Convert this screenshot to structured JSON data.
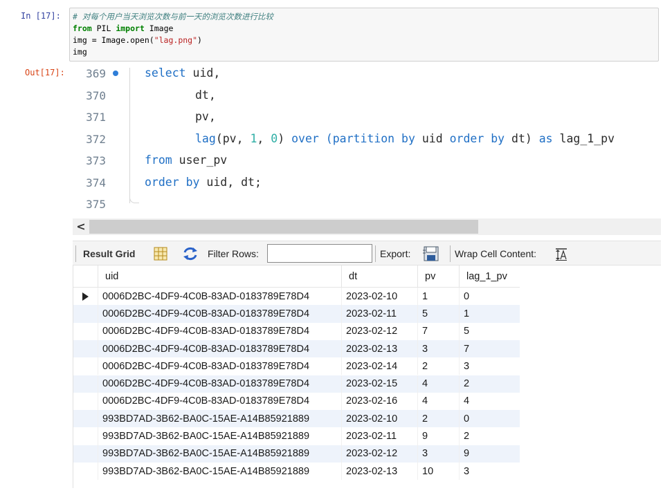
{
  "notebook": {
    "in_prompt": "In  [17]:",
    "out_prompt": "Out[17]:",
    "input_comment": "# 对每个用户当天浏览次数与前一天的浏览次数进行比较",
    "input_line2_kw1": "from",
    "input_line2_mid": " PIL ",
    "input_line2_kw2": "import",
    "input_line2_end": " Image",
    "input_line3_pre": "img = Image.open(",
    "input_line3_str": "\"lag.png\"",
    "input_line3_post": ")",
    "input_line4": "img"
  },
  "editor": {
    "lines": [
      {
        "num": "369"
      },
      {
        "num": "370"
      },
      {
        "num": "371"
      },
      {
        "num": "372"
      },
      {
        "num": "373"
      },
      {
        "num": "374"
      },
      {
        "num": "375"
      }
    ],
    "tokens": {
      "select": "select",
      "uid_comma": " uid,",
      "dt_comma": "dt,",
      "pv_comma": "pv,",
      "lag": "lag",
      "lag_args_a": "(pv, ",
      "one": "1",
      "comma_sp": ", ",
      "zero": "0",
      "close_paren": ")",
      "over": " over ",
      "paren_partition": "(partition by",
      "uid_sp": " uid ",
      "order_by": "order by",
      "dt_close": " dt) ",
      "as": "as",
      "alias": " lag_1_pv",
      "from": "from",
      "user_pv": " user_pv",
      "order_by2": "order by",
      "tail": " uid, dt;"
    }
  },
  "scrollbar": {
    "left_arrow": "<"
  },
  "toolbar": {
    "result_grid": "Result Grid",
    "filter_rows": "Filter Rows:",
    "filter_value": "",
    "export": "Export:",
    "wrap_cell": "Wrap Cell Content:",
    "icons": [
      "grid-icon",
      "refresh-icon",
      "export-icon",
      "wrap-icon"
    ]
  },
  "grid": {
    "columns": [
      "uid",
      "dt",
      "pv",
      "lag_1_pv"
    ],
    "rows": [
      [
        "0006D2BC-4DF9-4C0B-83AD-0183789E78D4",
        "2023-02-10",
        "1",
        "0"
      ],
      [
        "0006D2BC-4DF9-4C0B-83AD-0183789E78D4",
        "2023-02-11",
        "5",
        "1"
      ],
      [
        "0006D2BC-4DF9-4C0B-83AD-0183789E78D4",
        "2023-02-12",
        "7",
        "5"
      ],
      [
        "0006D2BC-4DF9-4C0B-83AD-0183789E78D4",
        "2023-02-13",
        "3",
        "7"
      ],
      [
        "0006D2BC-4DF9-4C0B-83AD-0183789E78D4",
        "2023-02-14",
        "2",
        "3"
      ],
      [
        "0006D2BC-4DF9-4C0B-83AD-0183789E78D4",
        "2023-02-15",
        "4",
        "2"
      ],
      [
        "0006D2BC-4DF9-4C0B-83AD-0183789E78D4",
        "2023-02-16",
        "4",
        "4"
      ],
      [
        "993BD7AD-3B62-BA0C-15AE-A14B85921889",
        "2023-02-10",
        "2",
        "0"
      ],
      [
        "993BD7AD-3B62-BA0C-15AE-A14B85921889",
        "2023-02-11",
        "9",
        "2"
      ],
      [
        "993BD7AD-3B62-BA0C-15AE-A14B85921889",
        "2023-02-12",
        "3",
        "9"
      ],
      [
        "993BD7AD-3B62-BA0C-15AE-A14B85921889",
        "2023-02-13",
        "10",
        "3"
      ]
    ]
  }
}
